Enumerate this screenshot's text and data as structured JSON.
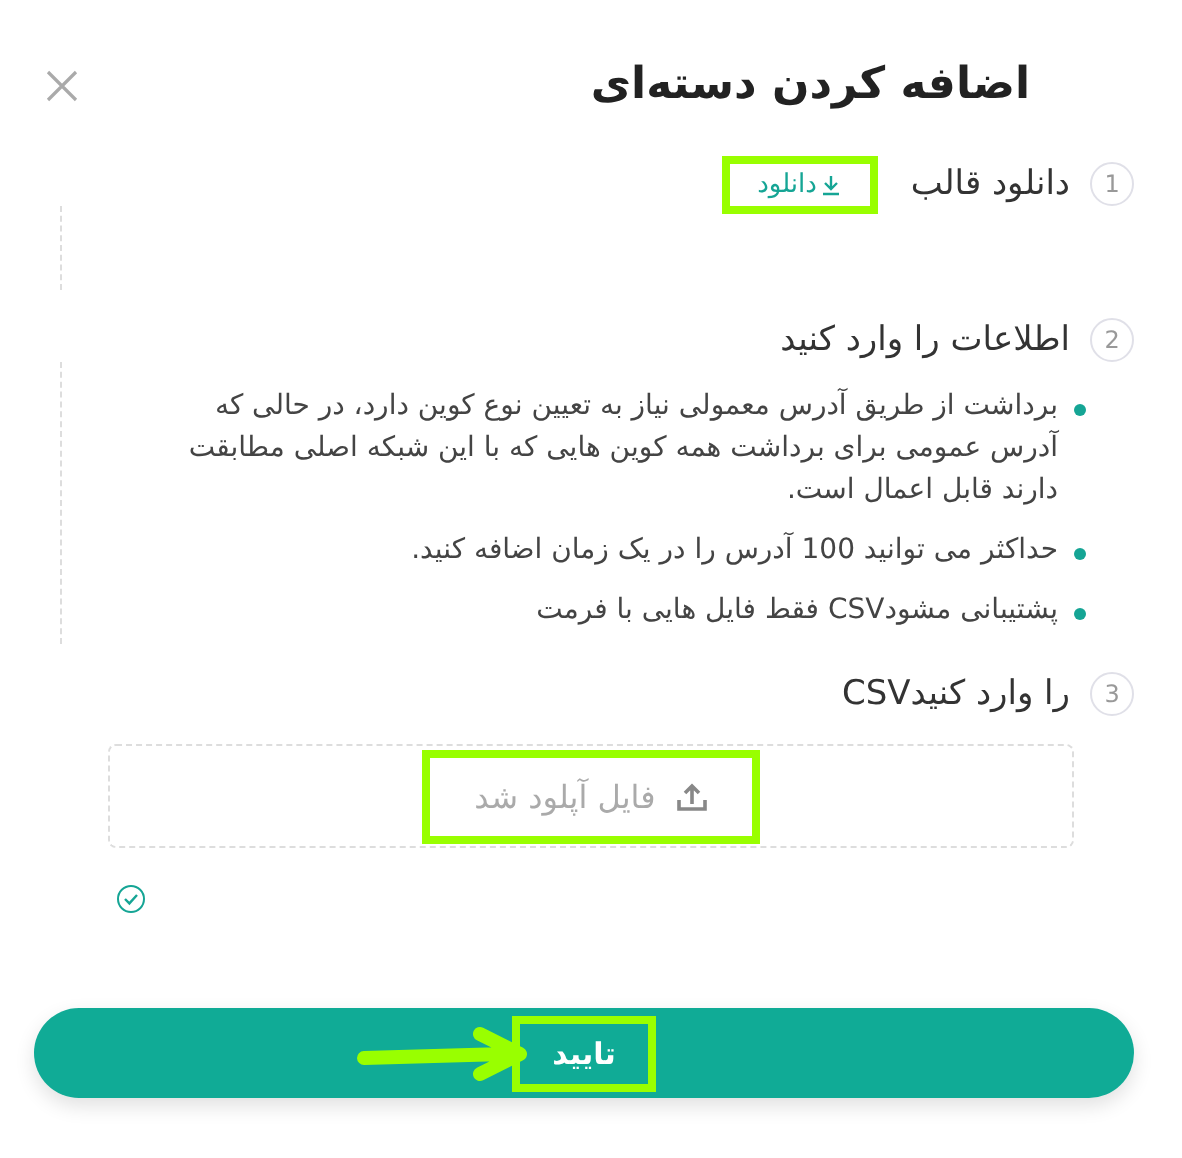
{
  "dialog": {
    "title": "اضافه کردن دسته‌ای"
  },
  "steps": [
    {
      "number": "1",
      "label": "دانلود قالب",
      "link": {
        "text": "دانلود",
        "highlighted": true
      }
    },
    {
      "number": "2",
      "label": "اطلاعات را وارد کنید",
      "bullets": [
        "برداشت از طریق آدرس معمولی نیاز به تعیین نوع کوین دارد، در حالی که آدرس عمومی برای برداشت همه کوین هایی که با این شبکه اصلی مطابقت دارند قابل اعمال است.",
        "حداکثر می توانید 100 آدرس را در یک زمان اضافه کنید.",
        "پشتیبانی مشودCSV فقط فایل هایی با فرمت"
      ]
    },
    {
      "number": "3",
      "label": "را وارد کنیدCSV",
      "upload": {
        "text": "فایل آپلود شد",
        "highlighted": true,
        "done": true
      }
    }
  ],
  "confirm": {
    "text": "تایید",
    "highlighted": true,
    "arrow": true
  }
}
